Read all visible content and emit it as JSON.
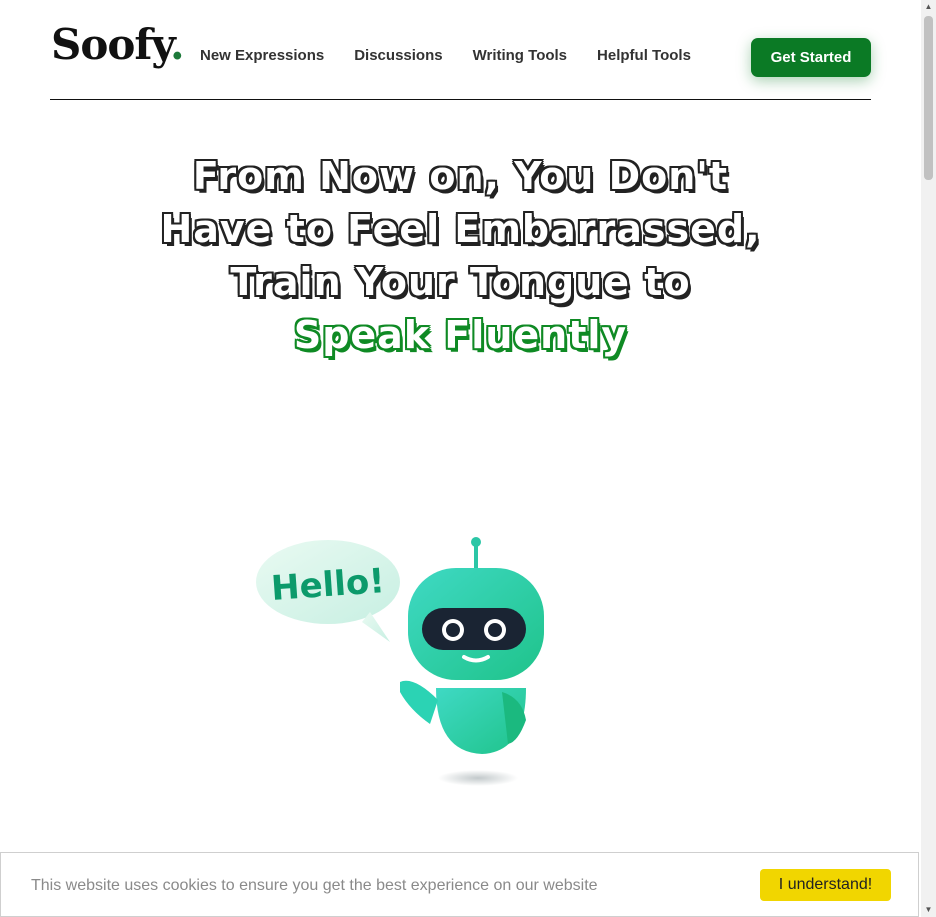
{
  "brand": {
    "logo_text": "Soofy",
    "logo_dot": ".",
    "accent_color": "#0b7a25"
  },
  "nav": {
    "items": [
      {
        "label": "New Expressions"
      },
      {
        "label": "Discussions"
      },
      {
        "label": "Writing Tools"
      },
      {
        "label": "Helpful Tools"
      }
    ],
    "cta_label": "Get Started"
  },
  "hero": {
    "lines": [
      "From Now on, You Don't",
      "Have to Feel Embarrassed,",
      "Train Your Tongue to"
    ],
    "accent_line": "Speak Fluently"
  },
  "illustration": {
    "bubble_text": "Hello!",
    "icon": "robot-mascot"
  },
  "cookie": {
    "message": "This website uses cookies to ensure you get the best experience on our website",
    "button_label": "I understand!",
    "button_color": "#f1d600"
  }
}
